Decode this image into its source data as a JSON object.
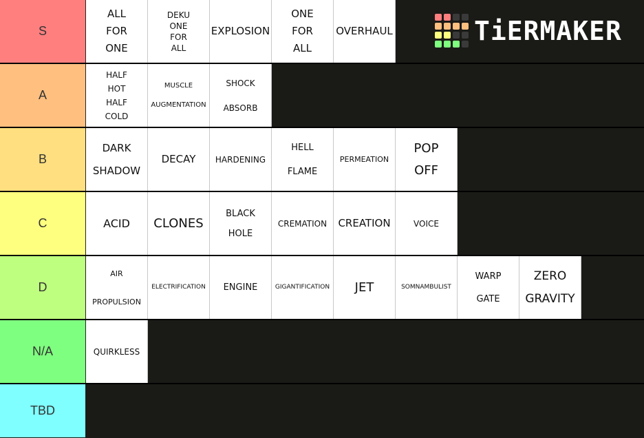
{
  "logo": {
    "text": "TiERMAKER",
    "grid_colors": [
      "#ff7f7f",
      "#ff7f7f",
      "#3a3a3a",
      "#3a3a3a",
      "#ffbf7f",
      "#ffbf7f",
      "#ffbf7f",
      "#ffbf7f",
      "#ffff7f",
      "#ffff7f",
      "#3a3a3a",
      "#3a3a3a",
      "#7fff7f",
      "#7fff7f",
      "#7fff7f",
      "#3a3a3a"
    ]
  },
  "tiers": [
    {
      "label": "S",
      "color": "#ff7f7f",
      "items": [
        {
          "lines": [
            "ALL",
            "FOR",
            "ONE"
          ],
          "size": 15,
          "gap": 10
        },
        {
          "lines": [
            "DEKU",
            "ONE",
            "FOR",
            "ALL"
          ],
          "size": 12,
          "gap": 4
        },
        {
          "lines": [
            "EXPLOSION"
          ],
          "size": 15,
          "gap": 0
        },
        {
          "lines": [
            "ONE",
            "FOR",
            "ALL"
          ],
          "size": 15,
          "gap": 10
        },
        {
          "lines": [
            "OVERHAUL"
          ],
          "size": 15,
          "gap": 0
        }
      ]
    },
    {
      "label": "A",
      "color": "#ffbf7f",
      "items": [
        {
          "lines": [
            "HALF",
            "HOT",
            "HALF",
            "COLD"
          ],
          "size": 12,
          "gap": 8
        },
        {
          "lines": [
            "MUSCLE",
            "AUGMENTATION"
          ],
          "size": 10,
          "gap": 18
        },
        {
          "lines": [
            "SHOCK",
            "ABSORB"
          ],
          "size": 12,
          "gap": 24
        }
      ]
    },
    {
      "label": "B",
      "color": "#ffdf7f",
      "items": [
        {
          "lines": [
            "DARK",
            "SHADOW"
          ],
          "size": 15,
          "gap": 18
        },
        {
          "lines": [
            "DECAY"
          ],
          "size": 15,
          "gap": 0
        },
        {
          "lines": [
            "HARDENING"
          ],
          "size": 12,
          "gap": 0
        },
        {
          "lines": [
            "HELL",
            "FLAME"
          ],
          "size": 13,
          "gap": 22
        },
        {
          "lines": [
            "PERMEATION"
          ],
          "size": 11,
          "gap": 0
        },
        {
          "lines": [
            "POP",
            "OFF"
          ],
          "size": 18,
          "gap": 14
        }
      ]
    },
    {
      "label": "C",
      "color": "#ffff7f",
      "items": [
        {
          "lines": [
            "ACID"
          ],
          "size": 16,
          "gap": 0
        },
        {
          "lines": [
            "CLONES"
          ],
          "size": 18,
          "gap": 0
        },
        {
          "lines": [
            "BLACK",
            "HOLE"
          ],
          "size": 13,
          "gap": 16
        },
        {
          "lines": [
            "CREMATION"
          ],
          "size": 12,
          "gap": 0
        },
        {
          "lines": [
            "CREATION"
          ],
          "size": 15,
          "gap": 0
        },
        {
          "lines": [
            "VOICE"
          ],
          "size": 12,
          "gap": 0
        }
      ]
    },
    {
      "label": "D",
      "color": "#bfff7f",
      "items": [
        {
          "lines": [
            "AIR",
            "PROPULSION"
          ],
          "size": 11,
          "gap": 30
        },
        {
          "lines": [
            "ELECTRIFICATION"
          ],
          "size": 9,
          "gap": 0
        },
        {
          "lines": [
            "ENGINE"
          ],
          "size": 13,
          "gap": 0
        },
        {
          "lines": [
            "GIGANTIFICATION"
          ],
          "size": 9,
          "gap": 0
        },
        {
          "lines": [
            "JET"
          ],
          "size": 18,
          "gap": 0
        },
        {
          "lines": [
            "SOMNAMBULIST"
          ],
          "size": 9,
          "gap": 0
        },
        {
          "lines": [
            "WARP",
            "GATE"
          ],
          "size": 13,
          "gap": 20
        },
        {
          "lines": [
            "ZERO",
            "GRAVITY"
          ],
          "size": 17,
          "gap": 16
        }
      ]
    },
    {
      "label": "N/A",
      "color": "#7fff7f",
      "items": [
        {
          "lines": [
            "QUIRKLESS"
          ],
          "size": 12,
          "gap": 0
        }
      ]
    },
    {
      "label": "TBD",
      "color": "#7fffff",
      "items": []
    }
  ]
}
